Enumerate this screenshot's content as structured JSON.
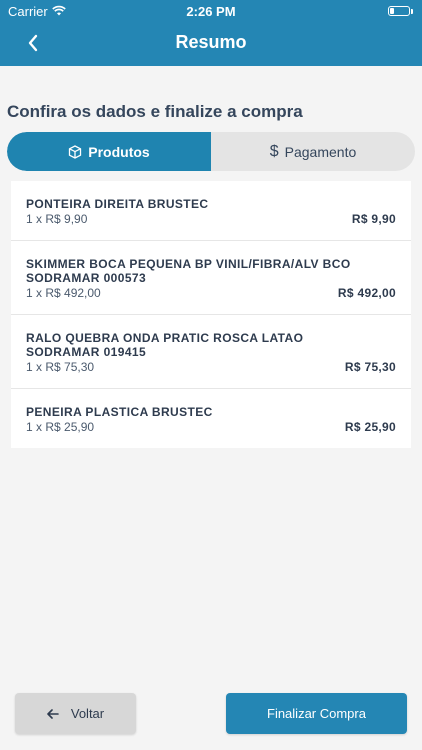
{
  "status_bar": {
    "carrier": "Carrier",
    "time": "2:26 PM"
  },
  "header": {
    "title": "Resumo"
  },
  "subtitle": "Confira os dados e finalize a compra",
  "tabs": [
    {
      "label": "Produtos",
      "icon": "box-icon",
      "active": true
    },
    {
      "label": "Pagamento",
      "icon": "dollar-icon",
      "active": false
    }
  ],
  "products": [
    {
      "name": "PONTEIRA DIREITA BRUSTEC",
      "qty": "1 x R$ 9,90",
      "total": "R$ 9,90"
    },
    {
      "name": "SKIMMER BOCA PEQUENA BP VINIL/FIBRA/ALV BCO SODRAMAR 000573",
      "qty": "1 x R$ 492,00",
      "total": "R$ 492,00"
    },
    {
      "name": "RALO QUEBRA ONDA PRATIC ROSCA LATAO SODRAMAR 019415",
      "qty": "1 x R$ 75,30",
      "total": "R$ 75,30"
    },
    {
      "name": "PENEIRA PLASTICA BRUSTEC",
      "qty": "1 x R$ 25,90",
      "total": "R$ 25,90"
    }
  ],
  "footer": {
    "back_label": "Voltar",
    "finish_label": "Finalizar Compra"
  },
  "colors": {
    "primary": "#2486b4",
    "background": "#f4f4f4"
  }
}
